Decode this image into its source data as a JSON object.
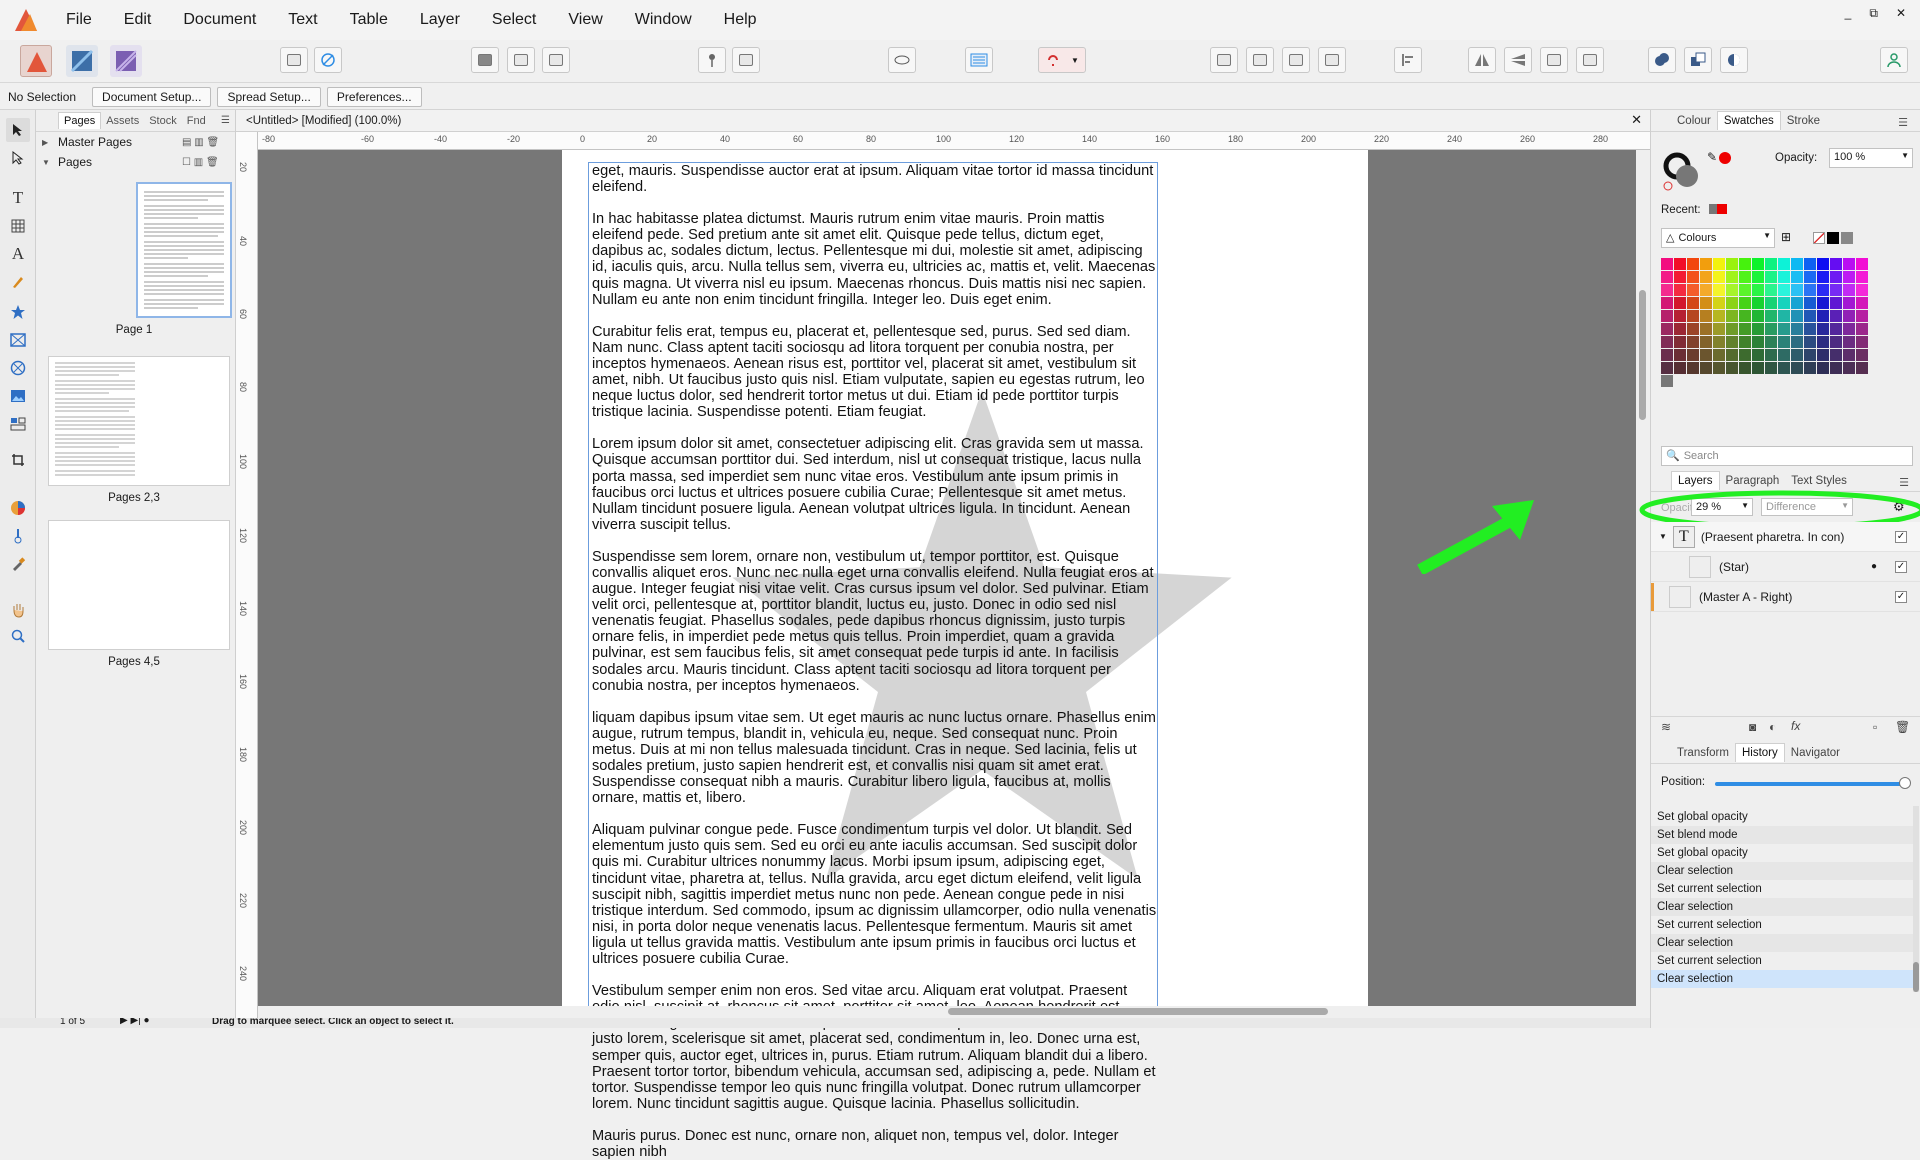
{
  "menubar": {
    "items": [
      "File",
      "Edit",
      "Document",
      "Text",
      "Table",
      "Layer",
      "Select",
      "View",
      "Window",
      "Help"
    ],
    "window_controls": [
      "_",
      "⧉",
      "✕"
    ]
  },
  "context_toolbar": {
    "selection_label": "No Selection",
    "buttons": [
      "Document Setup...",
      "Spread Setup...",
      "Preferences..."
    ]
  },
  "pages_panel": {
    "tabs": [
      "Pages",
      "Assets",
      "Stock",
      "Fnd"
    ],
    "active_tab": "Pages",
    "master_pages_label": "Master Pages",
    "pages_label": "Pages",
    "thumbnails": [
      "Page 1",
      "Pages 2,3",
      "Pages 4,5"
    ]
  },
  "document": {
    "title": "<Untitled> [Modified] (100.0%)",
    "ruler_unit": "mm",
    "ruler_h_labels": [
      "-80",
      "-60",
      "-40",
      "-20",
      "0",
      "20",
      "40",
      "60",
      "80",
      "100",
      "120",
      "140",
      "160",
      "180",
      "200",
      "220",
      "240",
      "260",
      "280"
    ],
    "ruler_v_labels": [
      "20",
      "40",
      "60",
      "80",
      "100",
      "120",
      "140",
      "160",
      "180",
      "200",
      "220",
      "240"
    ],
    "paragraphs": [
      "eget, mauris. Suspendisse auctor erat at ipsum. Aliquam vitae tortor id massa tincidunt eleifend.",
      "In hac habitasse platea dictumst. Mauris rutrum enim vitae mauris. Proin mattis eleifend pede. Sed pretium ante sit amet elit. Quisque pede tellus, dictum eget, dapibus ac, sodales dictum, lectus. Pellentesque mi dui, molestie sit amet, adipiscing id, iaculis quis, arcu. Nulla tellus sem, viverra eu, ultricies ac, mattis et, velit. Maecenas quis magna. Ut viverra nisl eu ipsum. Maecenas rhoncus. Duis mattis nisi nec sapien. Nullam eu ante non enim tincidunt fringilla. Integer leo. Duis eget enim.",
      "Curabitur felis erat, tempus eu, placerat et, pellentesque sed, purus. Sed sed diam. Nam nunc. Class aptent taciti sociosqu ad litora torquent per conubia nostra, per inceptos hymenaeos. Aenean risus est, porttitor vel, placerat sit amet, vestibulum sit amet, nibh. Ut faucibus justo quis nisl. Etiam vulputate, sapien eu egestas rutrum, leo neque luctus dolor, sed hendrerit tortor metus ut dui. Etiam id pede porttitor turpis tristique lacinia. Suspendisse potenti. Etiam feugiat.",
      "Lorem ipsum dolor sit amet, consectetuer adipiscing elit. Cras gravida sem ut massa. Quisque accumsan porttitor dui. Sed interdum, nisl ut consequat tristique, lacus nulla porta massa, sed imperdiet sem nunc vitae eros. Vestibulum ante ipsum primis in faucibus orci luctus et ultrices posuere cubilia Curae; Pellentesque sit amet metus. Nullam tincidunt posuere ligula. Aenean volutpat ultrices ligula. In tincidunt. Aenean viverra suscipit tellus.",
      "Suspendisse sem lorem, ornare non, vestibulum ut, tempor porttitor, est. Quisque convallis aliquet eros. Nunc nec nulla eget urna convallis eleifend. Nulla feugiat eros at augue. Integer feugiat nisi vitae velit. Cras cursus ipsum vel dolor. Sed pulvinar. Etiam velit orci, pellentesque at, porttitor blandit, luctus eu, justo. Donec in odio sed nisl venenatis feugiat. Phasellus sodales, pede dapibus rhoncus dignissim, justo turpis ornare felis, in imperdiet pede metus quis tellus. Proin imperdiet, quam a gravida pulvinar, est sem faucibus felis, sit amet consequat pede turpis id ante. In facilisis sodales arcu. Mauris tincidunt. Class aptent taciti sociosqu ad litora torquent per conubia nostra, per inceptos hymenaeos.",
      "liquam dapibus ipsum vitae sem. Ut eget mauris ac nunc luctus ornare. Phasellus enim augue, rutrum tempus, blandit in, vehicula eu, neque. Sed consequat nunc. Proin metus. Duis at mi non tellus malesuada tincidunt. Cras in neque. Sed lacinia, felis ut sodales pretium, justo sapien hendrerit est, et convallis nisi quam sit amet erat. Suspendisse consequat nibh a mauris. Curabitur libero ligula, faucibus at, mollis ornare, mattis et, libero.",
      "Aliquam pulvinar congue pede. Fusce condimentum turpis vel dolor. Ut blandit. Sed elementum justo quis sem. Sed eu orci eu ante iaculis accumsan. Sed suscipit dolor quis mi. Curabitur ultrices nonummy lacus. Morbi ipsum ipsum, adipiscing eget, tincidunt vitae, pharetra at, tellus. Nulla gravida, arcu eget dictum eleifend, velit ligula suscipit nibh, sagittis imperdiet metus nunc non pede. Aenean congue pede in nisi tristique interdum. Sed commodo, ipsum ac dignissim ullamcorper, odio nulla venenatis nisi, in porta dolor neque venenatis lacus. Pellentesque fermentum. Mauris sit amet ligula ut tellus gravida mattis. Vestibulum ante ipsum primis in faucibus orci luctus et ultrices posuere cubilia Curae.",
      "Vestibulum semper enim non eros. Sed vitae arcu. Aliquam erat volutpat. Praesent odio nisl, suscipit at, rhoncus sit amet, porttitor sit amet, leo. Aenean hendrerit est. Etiam ac augue. Morbi tincidunt neque ut lacus. Duis vulputate cursus orci. Mauris justo lorem, scelerisque sit amet, placerat sed, condimentum in, leo. Donec urna est, semper quis, auctor eget, ultrices in, purus. Etiam rutrum. Aliquam blandit dui a libero. Praesent tortor tortor, bibendum vehicula, accumsan sed, adipiscing a, pede. Nullam et tortor. Suspendisse tempor leo quis nunc fringilla volutpat. Donec rutrum ullamcorper lorem. Nunc tincidunt sagittis augue. Quisque lacinia. Phasellus sollicitudin.",
      "Mauris purus. Donec est nunc, ornare non, aliquet non, tempus vel, dolor. Integer sapien nibh"
    ]
  },
  "status_bar": {
    "page_indicator": "1 of 5",
    "hint": "Drag to marquee select. Click an object to select it."
  },
  "colour_panel": {
    "tabs": [
      "Colour",
      "Swatches",
      "Stroke"
    ],
    "active_tab": "Swatches",
    "opacity_label": "Opacity:",
    "opacity_value": "100 %",
    "recent_label": "Recent:",
    "palette_name": "Colours",
    "search_placeholder": "Search"
  },
  "layers_panel": {
    "tabs": [
      "Layers",
      "Paragraph",
      "Text Styles"
    ],
    "active_tab": "Layers",
    "opacity_label": "Opacity:",
    "opacity_value": "29 %",
    "blend_mode": "Difference",
    "layers": [
      {
        "name": "(Praesent pharetra. In con)",
        "visible": true
      },
      {
        "name": "(Star)",
        "visible": true
      },
      {
        "name": "(Master A - Right)",
        "visible": true
      }
    ]
  },
  "history_panel": {
    "tabs": [
      "Transform",
      "History",
      "Navigator"
    ],
    "active_tab": "History",
    "position_label": "Position:",
    "position_value": 1.0,
    "items": [
      "Set global opacity",
      "Set blend mode",
      "Set global opacity",
      "Clear selection",
      "Set current selection",
      "Clear selection",
      "Set current selection",
      "Clear selection",
      "Set current selection",
      "Clear selection"
    ],
    "selected_index": 9
  },
  "annotation": {
    "highlight_color": "#22ee22"
  },
  "colors": {
    "accent": "#2f8de4",
    "brand_publisher": "#e2563b"
  }
}
